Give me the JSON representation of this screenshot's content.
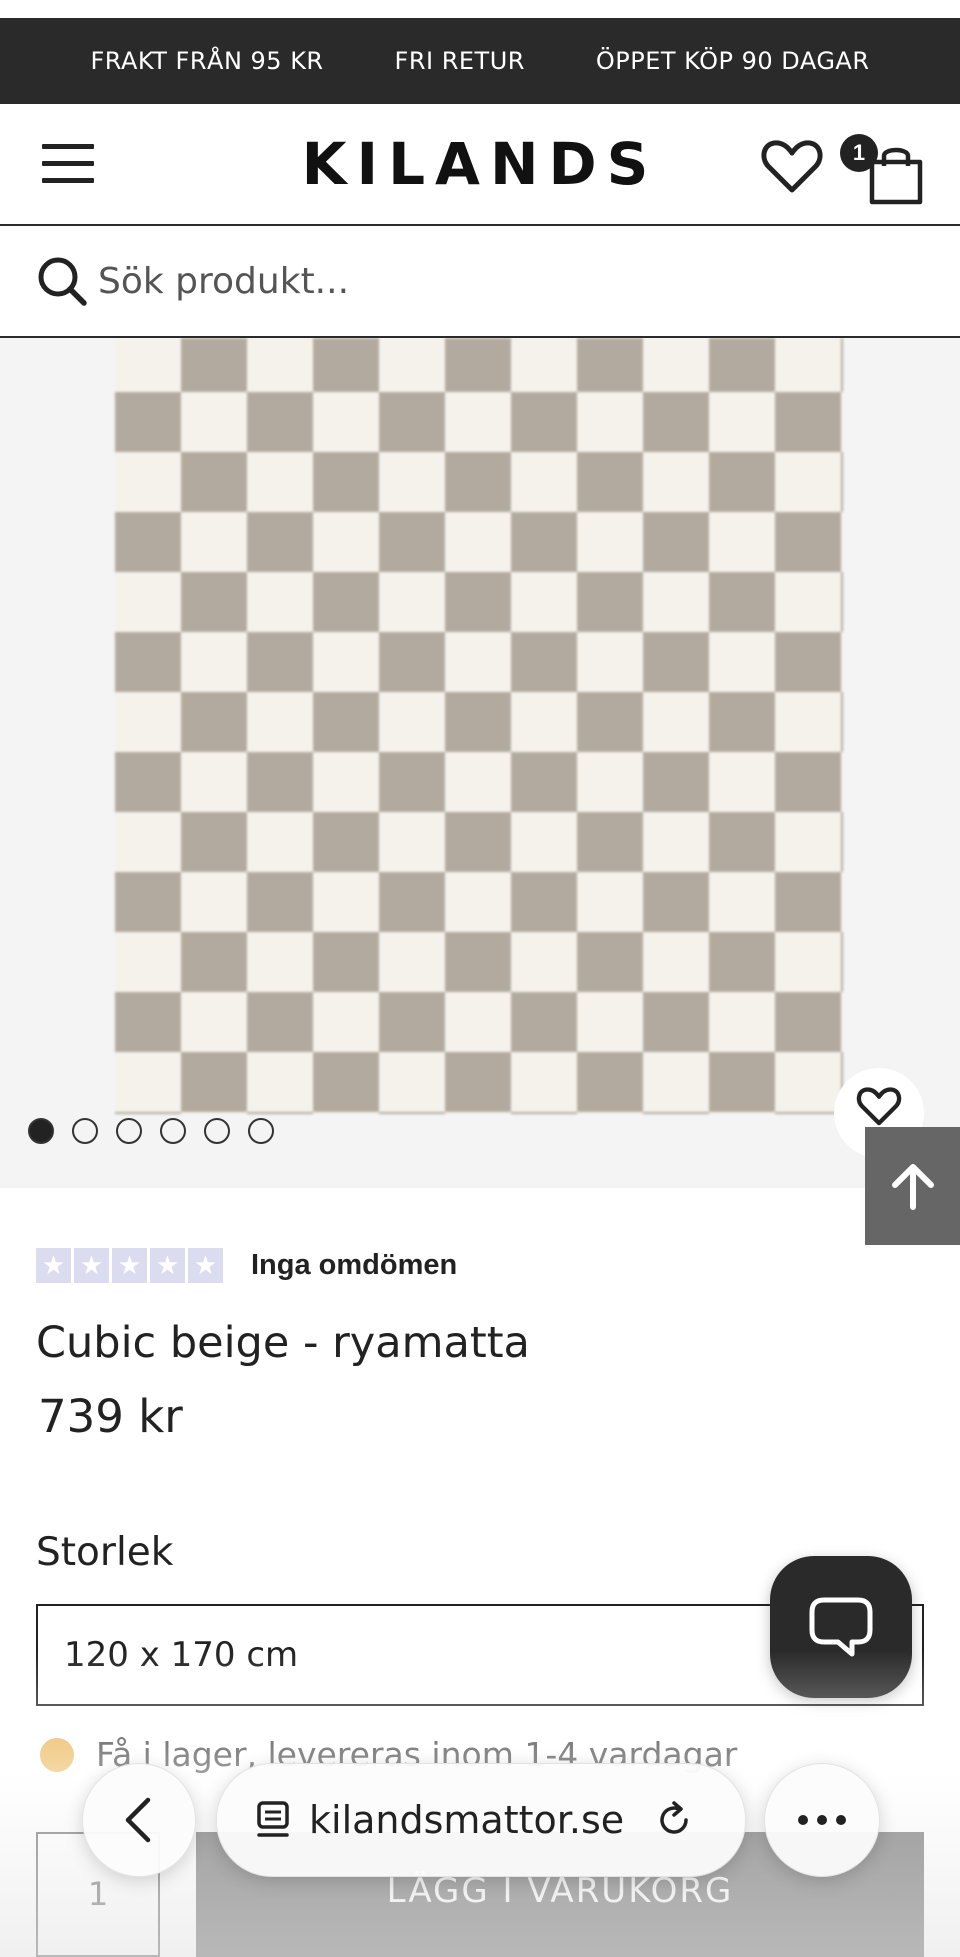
{
  "promo": {
    "items": [
      "FRAKT FRÅN 95 KR",
      "FRI RETUR",
      "ÖPPET KÖP 90 DAGAR"
    ]
  },
  "header": {
    "logo": "KILANDS",
    "cart_count": "1"
  },
  "search": {
    "placeholder": "Sök produkt..."
  },
  "gallery": {
    "image_count": 6,
    "active_index": 0
  },
  "product": {
    "rating_text": "Inga omdömen",
    "stars_filled": 0,
    "stars_total": 5,
    "title": "Cubic beige - ryamatta",
    "price": "739 kr",
    "size_label": "Storlek",
    "size_value": "120 x 170 cm",
    "stock_text": "Få i lager, levereras inom 1-4 vardagar",
    "stock_color": "#e8a93a",
    "quantity": "1",
    "add_to_cart": "LÄGG I VARUKORG"
  },
  "browser": {
    "url": "kilandsmattor.se"
  },
  "colors": {
    "dark": "#2a2a2a",
    "star_empty": "#dcdcf0"
  }
}
